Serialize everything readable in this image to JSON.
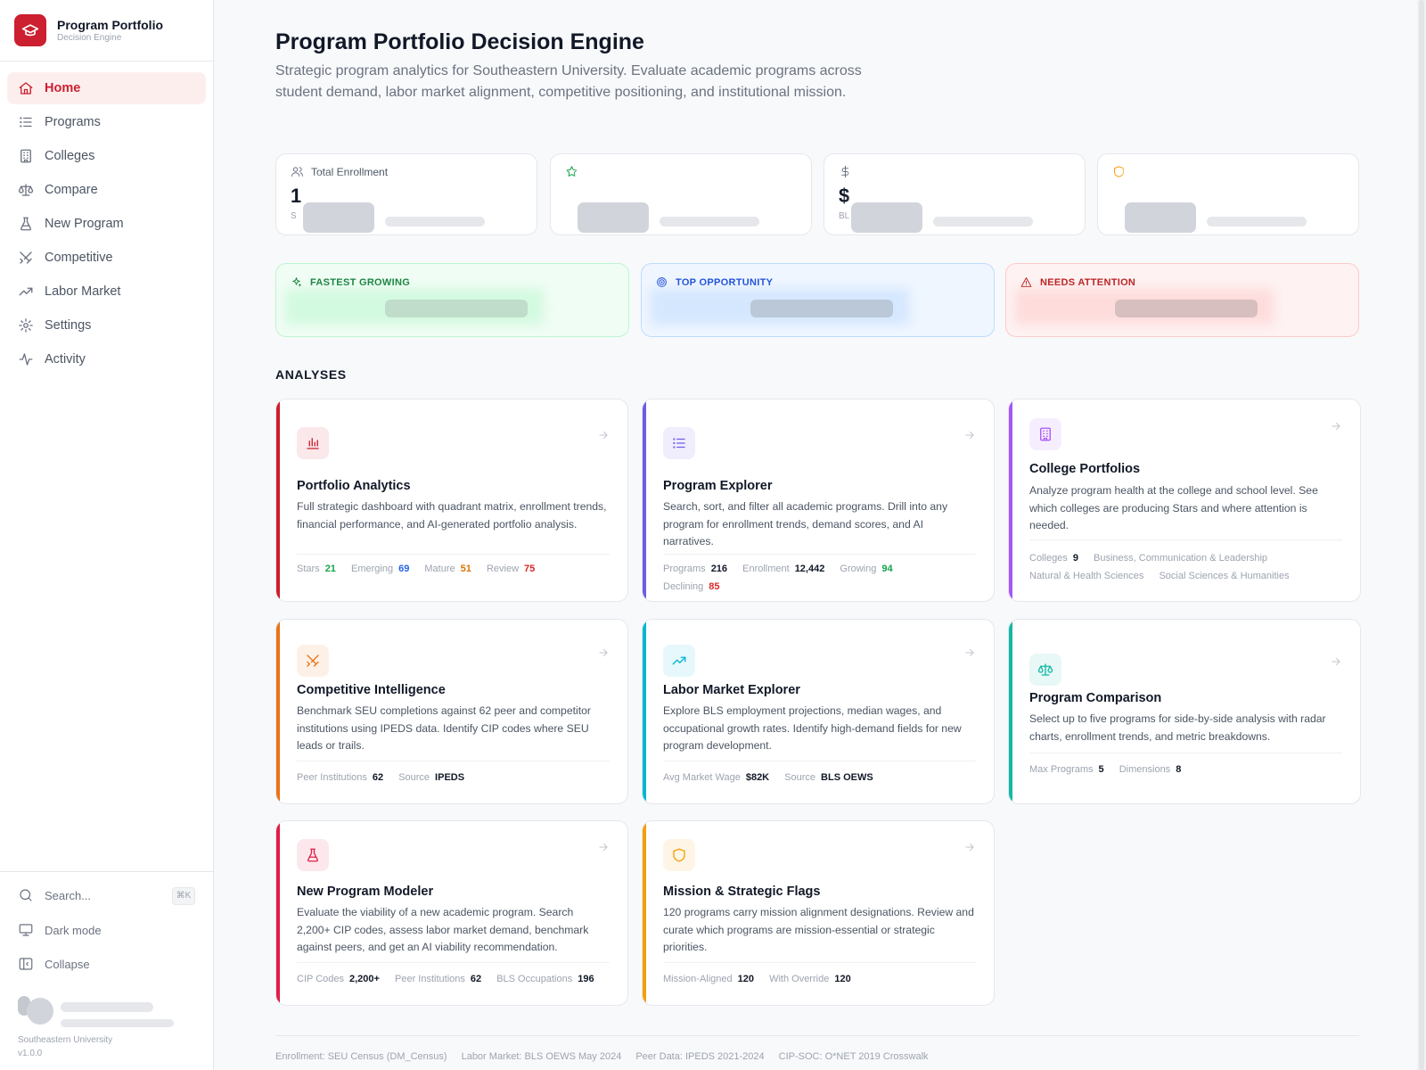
{
  "app": {
    "title": "Program Portfolio",
    "subtitle": "Decision Engine"
  },
  "nav": [
    {
      "label": "Home",
      "icon": "home-icon",
      "active": true
    },
    {
      "label": "Programs",
      "icon": "list-icon"
    },
    {
      "label": "Colleges",
      "icon": "building-icon"
    },
    {
      "label": "Compare",
      "icon": "scale-icon"
    },
    {
      "label": "New Program",
      "icon": "flask-icon"
    },
    {
      "label": "Competitive",
      "icon": "swords-icon"
    },
    {
      "label": "Labor Market",
      "icon": "trending-up-icon"
    },
    {
      "label": "Settings",
      "icon": "gear-icon"
    },
    {
      "label": "Activity",
      "icon": "activity-icon"
    }
  ],
  "sidebar_bottom": {
    "search_label": "Search...",
    "search_shortcut": "⌘K",
    "dark_mode_label": "Dark mode",
    "collapse_label": "Collapse",
    "org": "Southeastern University",
    "version": "v1.0.0"
  },
  "page": {
    "title": "Program Portfolio Decision Engine",
    "subtitle": "Strategic program analytics for Southeastern University. Evaluate academic programs across student demand, labor market alignment, competitive positioning, and institutional mission."
  },
  "stats": [
    {
      "label": "Total Enrollment",
      "value_partial": "1",
      "sub_partial": "S",
      "icon": "users-icon",
      "color": "#6b7280"
    },
    {
      "label": "",
      "value_partial": "",
      "sub_partial": "",
      "icon": "star-icon",
      "color": "#16a34a"
    },
    {
      "label": "",
      "value_partial": "$",
      "sub_partial": "BL",
      "icon": "dollar-icon",
      "color": "#6b7280"
    },
    {
      "label": "",
      "value_partial": "",
      "sub_partial": "",
      "icon": "shield-icon",
      "color": "#f59e0b"
    }
  ],
  "highlights": [
    {
      "label": "FASTEST GROWING",
      "icon": "sparkle-icon",
      "color": "#15803d",
      "bg": "#f0fdf4",
      "border": "#bbf7d0"
    },
    {
      "label": "TOP OPPORTUNITY",
      "icon": "target-icon",
      "color": "#1d4ed8",
      "bg": "#eff6ff",
      "border": "#bfdbfe"
    },
    {
      "label": "NEEDS ATTENTION",
      "icon": "alert-triangle-icon",
      "color": "#b91c1c",
      "bg": "#fef2f2",
      "border": "#fecaca"
    }
  ],
  "section_title": "ANALYSES",
  "cards": [
    {
      "title": "Portfolio Analytics",
      "desc": "Full strategic dashboard with quadrant matrix, enrollment trends, financial performance, and AI-generated portfolio analysis.",
      "accent": "#cc1f2f",
      "icon": "bar-chart-icon",
      "meta": [
        {
          "k": "Stars",
          "v": "21",
          "c": "#16a34a"
        },
        {
          "k": "Emerging",
          "v": "69",
          "c": "#2563eb"
        },
        {
          "k": "Mature",
          "v": "51",
          "c": "#d97706"
        },
        {
          "k": "Review",
          "v": "75",
          "c": "#dc2626"
        }
      ]
    },
    {
      "title": "Program Explorer",
      "desc": "Search, sort, and filter all academic programs. Drill into any program for enrollment trends, demand scores, and AI narratives.",
      "accent": "#6d5ce8",
      "icon": "list-icon",
      "meta": [
        {
          "k": "Programs",
          "v": "216",
          "c": "#111827"
        },
        {
          "k": "Enrollment",
          "v": "12,442",
          "c": "#111827"
        },
        {
          "k": "Growing",
          "v": "94",
          "c": "#16a34a"
        },
        {
          "k": "Declining",
          "v": "85",
          "c": "#dc2626"
        }
      ]
    },
    {
      "title": "College Portfolios",
      "desc": "Analyze program health at the college and school level. See which colleges are producing Stars and where attention is needed.",
      "accent": "#a855f7",
      "icon": "building-icon",
      "meta": [
        {
          "k": "Colleges",
          "v": "9",
          "c": "#111827"
        },
        {
          "k": "Business, Communication & Leadership",
          "v": "",
          "c": "#111827"
        },
        {
          "k": "Natural & Health Sciences",
          "v": "",
          "c": "#111827"
        },
        {
          "k": "Social Sciences & Humanities",
          "v": "",
          "c": "#111827"
        }
      ]
    },
    {
      "title": "Competitive Intelligence",
      "desc": "Benchmark SEU completions against 62 peer and competitor institutions using IPEDS data. Identify CIP codes where SEU leads or trails.",
      "accent": "#ea7317",
      "icon": "swords-icon",
      "meta": [
        {
          "k": "Peer Institutions",
          "v": "62",
          "c": "#111827"
        },
        {
          "k": "Source",
          "v": "IPEDS",
          "c": "#111827"
        }
      ]
    },
    {
      "title": "Labor Market Explorer",
      "desc": "Explore BLS employment projections, median wages, and occupational growth rates. Identify high-demand fields for new program development.",
      "accent": "#06b6d4",
      "icon": "trending-up-icon",
      "meta": [
        {
          "k": "Avg Market Wage",
          "v": "$82K",
          "c": "#111827"
        },
        {
          "k": "Source",
          "v": "BLS OEWS",
          "c": "#111827"
        }
      ]
    },
    {
      "title": "Program Comparison",
      "desc": "Select up to five programs for side-by-side analysis with radar charts, enrollment trends, and metric breakdowns.",
      "accent": "#14b8a6",
      "icon": "scale-icon",
      "meta": [
        {
          "k": "Max Programs",
          "v": "5",
          "c": "#111827"
        },
        {
          "k": "Dimensions",
          "v": "8",
          "c": "#111827"
        }
      ]
    },
    {
      "title": "New Program Modeler",
      "desc": "Evaluate the viability of a new academic program. Search 2,200+ CIP codes, assess labor market demand, benchmark against peers, and get an AI viability recommendation.",
      "accent": "#e11d48",
      "icon": "flask-icon",
      "meta": [
        {
          "k": "CIP Codes",
          "v": "2,200+",
          "c": "#111827"
        },
        {
          "k": "Peer Institutions",
          "v": "62",
          "c": "#111827"
        },
        {
          "k": "BLS Occupations",
          "v": "196",
          "c": "#111827"
        }
      ]
    },
    {
      "title": "Mission & Strategic Flags",
      "desc": "120 programs carry mission alignment designations. Review and curate which programs are mission-essential or strategic priorities.",
      "accent": "#f59e0b",
      "icon": "shield-icon",
      "meta": [
        {
          "k": "Mission-Aligned",
          "v": "120",
          "c": "#111827"
        },
        {
          "k": "With Override",
          "v": "120",
          "c": "#111827"
        }
      ]
    }
  ],
  "footer": [
    "Enrollment: SEU Census (DM_Census)",
    "Labor Market: BLS OEWS May 2024",
    "Peer Data: IPEDS 2021-2024",
    "CIP-SOC: O*NET 2019 Crosswalk"
  ]
}
